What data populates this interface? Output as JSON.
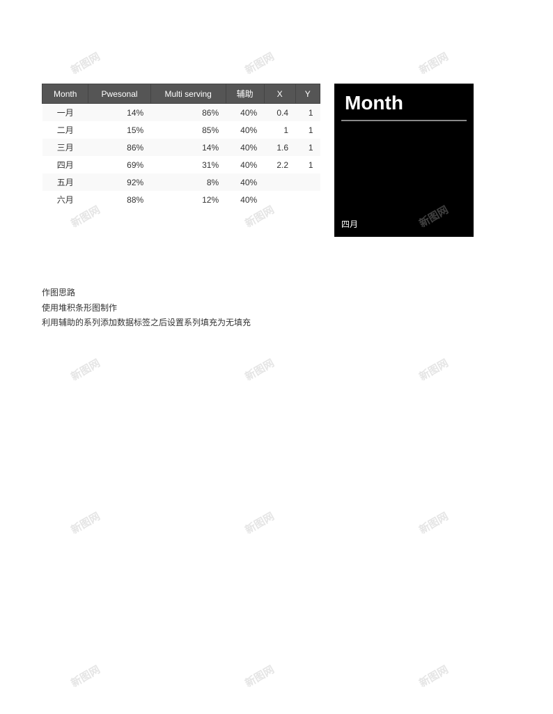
{
  "watermark_text": "新图网",
  "table": {
    "headers": [
      "Month",
      "Pwesonal",
      "Multi serving",
      "辅助",
      "X",
      "Y"
    ],
    "rows": [
      {
        "month": "一月",
        "pwesonal": "14%",
        "multi_serving": "86%",
        "fu_zhu": "40%",
        "x": "0.4",
        "y": "1"
      },
      {
        "month": "二月",
        "pwesonal": "15%",
        "multi_serving": "85%",
        "fu_zhu": "40%",
        "x": "1",
        "y": "1"
      },
      {
        "month": "三月",
        "pwesonal": "86%",
        "multi_serving": "14%",
        "fu_zhu": "40%",
        "x": "1.6",
        "y": "1"
      },
      {
        "month": "四月",
        "pwesonal": "69%",
        "multi_serving": "31%",
        "fu_zhu": "40%",
        "x": "2.2",
        "y": "1"
      },
      {
        "month": "五月",
        "pwesonal": "92%",
        "multi_serving": "8%",
        "fu_zhu": "40%",
        "x": "",
        "y": ""
      },
      {
        "month": "六月",
        "pwesonal": "88%",
        "multi_serving": "12%",
        "fu_zhu": "40%",
        "x": "",
        "y": ""
      }
    ]
  },
  "chart": {
    "title": "Month",
    "bottom_label": "四月"
  },
  "notes": {
    "title": "作图思路",
    "line1": "使用堆积条形图制作",
    "line2": "利用辅助的系列添加数据标签之后设置系列填充为无填充"
  }
}
